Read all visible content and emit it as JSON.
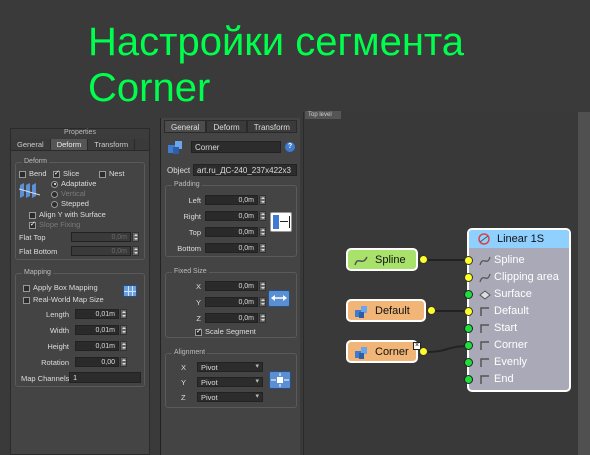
{
  "heading": {
    "line1": "Настройки сегмента",
    "line2": "Corner"
  },
  "left_panel": {
    "title": "Properties",
    "tabs": [
      "General",
      "Deform",
      "Transform"
    ],
    "deform": {
      "group": "Deform",
      "bend": "Bend",
      "slice": "Slice",
      "nest": "Nest",
      "adaptative": "Adaptative",
      "vertical": "Vertical",
      "stepped": "Stepped",
      "align_y": "Align Y with Surface",
      "slope_fixing": "Slope Fixing",
      "flat_top": "Flat Top",
      "flat_top_value": "0,0m",
      "flat_bottom": "Flat Bottom",
      "flat_bottom_value": "0,0m"
    },
    "mapping": {
      "group": "Mapping",
      "apply_box": "Apply Box Mapping",
      "real_world": "Real-World Map Size",
      "length": "Length",
      "length_value": "0,01m",
      "width": "Width",
      "width_value": "0,01m",
      "height": "Height",
      "height_value": "0,01m",
      "rotation": "Rotation",
      "rotation_value": "0,00",
      "map_channels": "Map Channels",
      "map_channels_value": "1"
    }
  },
  "mid_panel": {
    "tabs": [
      "General",
      "Deform",
      "Transform"
    ],
    "name_value": "Corner",
    "help": "?",
    "object_label": "Object",
    "object_value": "art.ru_ДС-240_237x422x3",
    "padding": {
      "group": "Padding",
      "left": "Left",
      "right": "Right",
      "top": "Top",
      "bottom": "Bottom",
      "left_value": "0,0m",
      "right_value": "0,0m",
      "top_value": "0,0m",
      "bottom_value": "0,0m"
    },
    "fixed_size": {
      "group": "Fixed Size",
      "x": "X",
      "y": "Y",
      "z": "Z",
      "x_value": "0,0m",
      "y_value": "0,0m",
      "z_value": "0,0m",
      "scale_segment": "Scale Segment"
    },
    "alignment": {
      "group": "Alignment",
      "x": "X",
      "y": "Y",
      "z": "Z",
      "x_value": "Pivot",
      "y_value": "Pivot",
      "z_value": "Pivot"
    }
  },
  "node_editor": {
    "tab": "Top level",
    "nodes": {
      "spline": "Spline",
      "default": "Default",
      "corner": "Corner",
      "linear_title": "Linear 1S",
      "linear_rows": [
        "Spline",
        "Clipping area",
        "Surface",
        "Default",
        "Start",
        "Corner",
        "Evenly",
        "End"
      ]
    }
  },
  "colors": {
    "heading": "#00ff4c",
    "spline_node": "#a8e26a",
    "default_node": "#f0b577",
    "corner_node": "#f0b577",
    "linear_header": "#8fd0ff",
    "linear_body": "#a9a9b8",
    "port": "#ffff2a",
    "port_green": "#1be03a"
  }
}
